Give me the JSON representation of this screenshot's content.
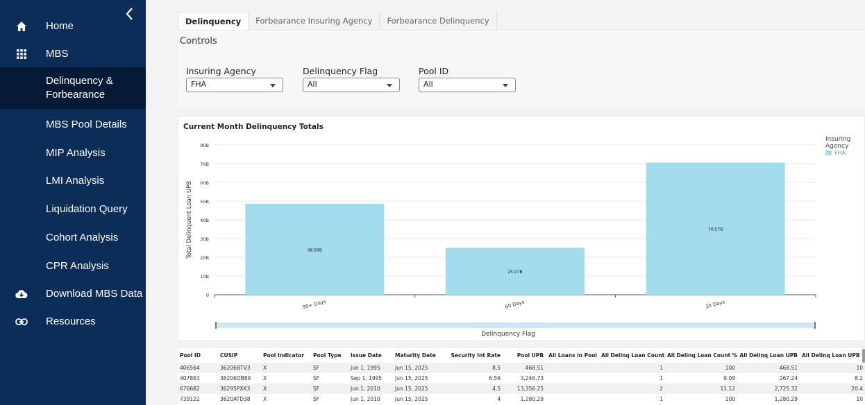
{
  "sidebar": {
    "items": [
      {
        "label": "Home",
        "icon": "home-icon",
        "active": false
      },
      {
        "label": "MBS",
        "icon": "grid-icon",
        "active": false
      },
      {
        "label": "Delinquency & Forbearance",
        "line1": "Delinquency &",
        "line2": "Forbearance",
        "icon": "",
        "active": true
      },
      {
        "label": "MBS Pool Details",
        "icon": "",
        "active": false
      },
      {
        "label": "MIP Analysis",
        "icon": "",
        "active": false
      },
      {
        "label": "LMI Analysis",
        "icon": "",
        "active": false
      },
      {
        "label": "Liquidation Query",
        "icon": "",
        "active": false
      },
      {
        "label": "Cohort Analysis",
        "icon": "",
        "active": false
      },
      {
        "label": "CPR Analysis",
        "icon": "",
        "active": false
      },
      {
        "label": "Download MBS Data",
        "icon": "cloud-download-icon",
        "active": false
      },
      {
        "label": "Resources",
        "icon": "link-icon",
        "active": false
      }
    ],
    "collapse_icon": "chevron-left-icon"
  },
  "tabs": [
    {
      "label": "Delinquency",
      "active": true
    },
    {
      "label": "Forbearance Insuring Agency",
      "active": false
    },
    {
      "label": "Forbearance Delinquency",
      "active": false
    }
  ],
  "controls": {
    "title": "Controls",
    "filters": [
      {
        "label": "Insuring Agency",
        "value": "FHA"
      },
      {
        "label": "Delinquency Flag",
        "value": "All"
      },
      {
        "label": "Pool ID",
        "value": "All"
      }
    ]
  },
  "chart_data": {
    "type": "bar",
    "title": "Current Month Delinquency Totals",
    "xlabel": "Delinquency Flag",
    "ylabel": "Total Delinquent Loan UPB",
    "categories": [
      "90+ Days",
      "60 Days",
      "30 Days"
    ],
    "values": [
      48.56,
      25.07,
      70.57
    ],
    "data_labels": [
      "48.56B",
      "25.07B",
      "70.57B"
    ],
    "yticks": [
      "0",
      "10B",
      "20B",
      "30B",
      "40B",
      "50B",
      "60B",
      "70B",
      "80B"
    ],
    "ylim": [
      0,
      80
    ],
    "series": [
      {
        "name": "FHA",
        "color": "#a2dbeb"
      }
    ],
    "legend_title": "Insuring Agency",
    "legend_position": "right",
    "grid": true
  },
  "table": {
    "columns": [
      "Pool ID",
      "CUSIP",
      "Pool Indicator",
      "Pool Type",
      "Issue Date",
      "Maturity Date",
      "Security Int Rate",
      "Pool UPB",
      "All Loans in Pool",
      "All Delinq Loan Count",
      "All Delinq Loan Count %",
      "All Delinq Loan UPB",
      "All Delinq Loan UPB %"
    ],
    "rows": [
      [
        "406564",
        "36206BTV3",
        "X",
        "SF",
        "Jun 1, 1995",
        "Jun 15, 2025",
        "8.5",
        "468.51",
        "",
        "1",
        "100",
        "468.51",
        "10"
      ],
      [
        "407863",
        "36206DB89",
        "X",
        "SF",
        "Sep 1, 1995",
        "Jun 15, 2025",
        "6.56",
        "3,246.73",
        "",
        "1",
        "9.09",
        "267.24",
        "8.2"
      ],
      [
        "676682",
        "36295PXK3",
        "X",
        "SF",
        "Jun 1, 2010",
        "Jun 15, 2025",
        "4.5",
        "13,356.25",
        "",
        "2",
        "11.12",
        "2,725.32",
        "20.4"
      ],
      [
        "739122",
        "3620ATD38",
        "X",
        "SF",
        "Jun 1, 2010",
        "Jun 15, 2025",
        "4",
        "1,280.29",
        "",
        "1",
        "100",
        "1,280.29",
        "10"
      ]
    ]
  }
}
